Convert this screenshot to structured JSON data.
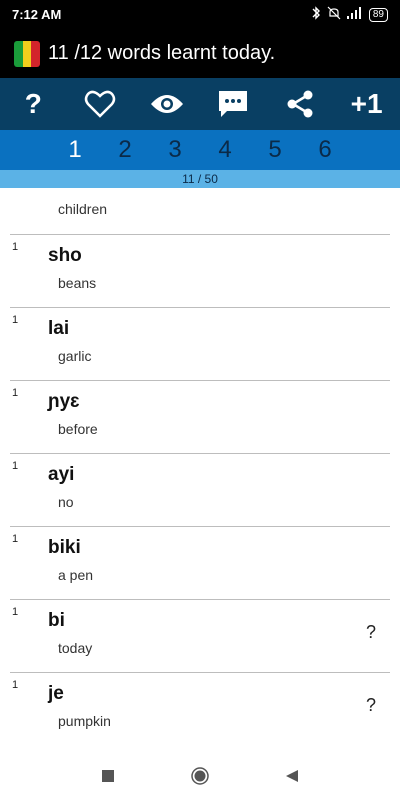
{
  "status": {
    "time": "7:12 AM",
    "battery": "89"
  },
  "title": "11 /12 words learnt today.",
  "toolbar": {
    "plus_label": "+1",
    "help_label": "?"
  },
  "levels": [
    "1",
    "2",
    "3",
    "4",
    "5",
    "6"
  ],
  "progress": "11 / 50",
  "first_row_meaning": "children",
  "rows": [
    {
      "count": "1",
      "word": "sho",
      "meaning": "beans",
      "has_q": false
    },
    {
      "count": "1",
      "word": "lai",
      "meaning": "garlic",
      "has_q": false
    },
    {
      "count": "1",
      "word": "ɲyɛ",
      "meaning": "before",
      "has_q": false
    },
    {
      "count": "1",
      "word": "ayi",
      "meaning": "no",
      "has_q": false
    },
    {
      "count": "1",
      "word": "biki",
      "meaning": "a pen",
      "has_q": false
    },
    {
      "count": "1",
      "word": "bi",
      "meaning": "today",
      "has_q": true,
      "q": "?"
    },
    {
      "count": "1",
      "word": "je",
      "meaning": "pumpkin",
      "has_q": true,
      "q": "?"
    }
  ],
  "colors": {
    "toolbar": "#093f63",
    "levels": "#0a71c0",
    "progress": "#5bb2e6"
  }
}
